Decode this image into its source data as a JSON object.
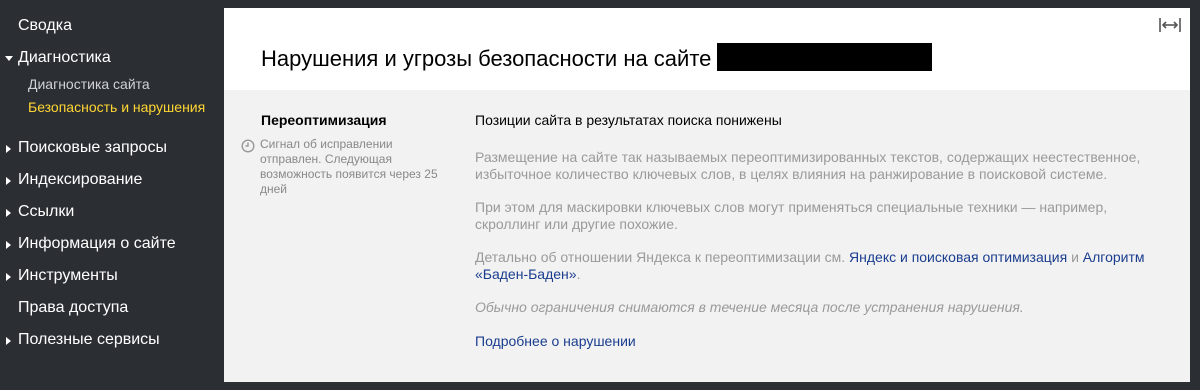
{
  "sidebar": {
    "items": [
      {
        "label": "Сводка",
        "arrow": "none"
      },
      {
        "label": "Диагностика",
        "arrow": "down"
      },
      {
        "label": "Поисковые запросы",
        "arrow": "right"
      },
      {
        "label": "Индексирование",
        "arrow": "right"
      },
      {
        "label": "Ссылки",
        "arrow": "right"
      },
      {
        "label": "Информация о сайте",
        "arrow": "right"
      },
      {
        "label": "Инструменты",
        "arrow": "right"
      },
      {
        "label": "Права доступа",
        "arrow": "none"
      },
      {
        "label": "Полезные сервисы",
        "arrow": "right"
      }
    ],
    "subitems": [
      {
        "label": "Диагностика сайта",
        "active": false
      },
      {
        "label": "Безопасность и нарушения",
        "active": true
      }
    ],
    "active_color": "#ffd633"
  },
  "header": {
    "title": "Нарушения и угрозы безопасности на сайте",
    "expand_icon": "expand-horizontal-icon"
  },
  "violation": {
    "name": "Переоптимизация",
    "signal_icon": "clock-icon",
    "signal_text": "Сигнал об исправлении отправлен. Следующая возможность появится через 25 дней",
    "heading": "Позиции сайта в результатах поиска понижены",
    "paragraph1": "Размещение на сайте так называемых переоптимизированных текстов, содержащих неестественное, избыточное количество ключевых слов, в целях влияния на ранжирование в поисковой системе.",
    "paragraph2": "При этом для маскировки ключевых слов могут применяться специальные техники — например, скроллинг или другие похожие.",
    "paragraph3_prefix": "Детально об отношении Яндекса к переоптимизации см.",
    "link1": "Яндекс и поисковая оптимизация",
    "paragraph3_and": "и",
    "link2": "Алгоритм «Баден-Баден»",
    "paragraph3_suffix": ".",
    "italic_note": "Обычно ограничения снимаются в течение месяца после устранения нарушения.",
    "more_link": "Подробнее о нарушении"
  },
  "colors": {
    "sidebar_bg": "#2b2e33",
    "link": "#1a3d8f"
  }
}
